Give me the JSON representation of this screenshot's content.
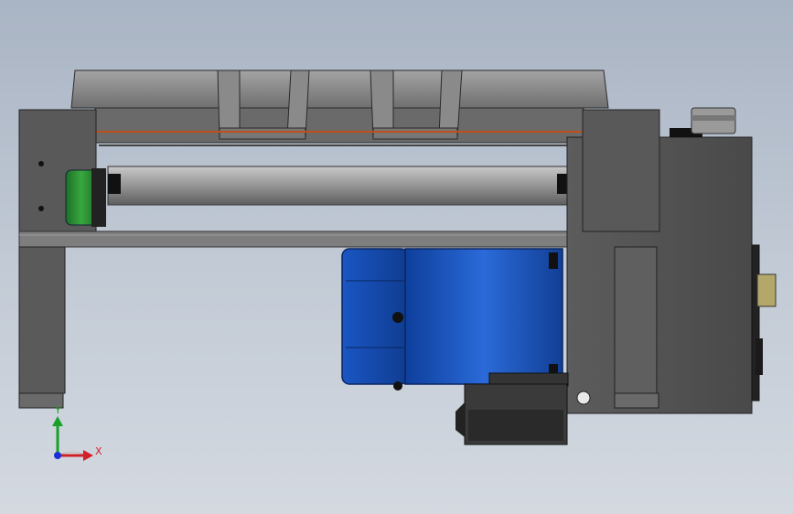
{
  "viewport": {
    "background_top": "#a9b4c4",
    "background_bottom": "#d4d9e0"
  },
  "model": {
    "frame_color": "#555555",
    "roller_color": "#8e8e8e",
    "pulley_color": "#2e8a35",
    "belt_color": "#c0501a",
    "motor_color": "#1f5ac2",
    "gearbox_color": "#3a3a3a"
  },
  "triad": {
    "x_label": "X",
    "y_label": "Y",
    "x_color": "#d0202a",
    "y_color": "#18a02a",
    "z_color": "#1a2fd8"
  }
}
